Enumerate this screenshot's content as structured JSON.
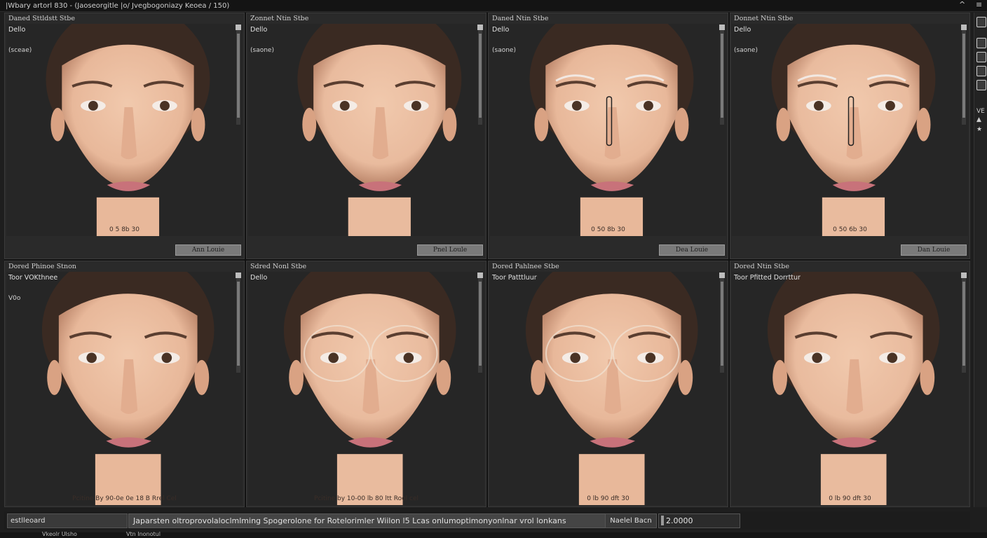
{
  "window": {
    "title": "|Wbary artorl 830 - (Jaoseorgitle |o/ Jvegbogoniazy Keoea / 150)",
    "minimize": "^",
    "close": "≡"
  },
  "panels": [
    {
      "title": "Daned Sttldstt Stbe",
      "top": "Dello",
      "sub": "(sceae)",
      "button": "Ann Louie",
      "caption": "0 5 8b 30"
    },
    {
      "title": "Zonnet Ntin Stbe",
      "top": "Dello",
      "sub": "(saone)",
      "button": "Pnel Loule",
      "caption": ""
    },
    {
      "title": "Daned Ntin Stbe",
      "top": "Dello",
      "sub": "(saone)",
      "button": "Dea Louie",
      "caption": "0 50 8b 30"
    },
    {
      "title": "Donnet Ntin Stbe",
      "top": "Dello",
      "sub": "(saone)",
      "button": "Dan Louie",
      "caption": "0 50 6b 30"
    },
    {
      "title": "Dored Phinoe Stnon",
      "top": "Toor VOKthnee",
      "sub": "V0o",
      "button": "",
      "caption": "Pcitine By 90-0e 0e 18 B Rrel Cel"
    },
    {
      "title": "Sdred Nonl Stbe",
      "top": "Dello",
      "sub": "",
      "button": "",
      "caption": "Pcitine by 10-00 lb 80 ltt Roel cel"
    },
    {
      "title": "Dored Pahlnee Stbe",
      "top": "Toor Patttluur",
      "sub": "",
      "button": "",
      "caption": "0 lb 90 dft 30"
    },
    {
      "title": "Dored Ntin Stbe",
      "top": "Toor Pfitted Dorrttur",
      "sub": "",
      "button": "",
      "caption": "0 lb 90 dft 30"
    }
  ],
  "right_toolbar": {
    "label1": "VE",
    "label2": "▲",
    "label3": "★"
  },
  "status": {
    "left": "estlleoard",
    "main": "Japarsten oltroprovolaloclmlming Spogerolone for Rotelorimler Wiilon l5 Lcas onlumoptimonyonlnar vrol lonkans",
    "tag": "Naelel Bacn",
    "value": "2.0000"
  },
  "bottom_strip": {
    "a": "Vkeolr Ulsho",
    "b": "Vtn  Inonotul"
  },
  "colors": {
    "panel": "#2a2a2a",
    "accent": "#e04040"
  }
}
